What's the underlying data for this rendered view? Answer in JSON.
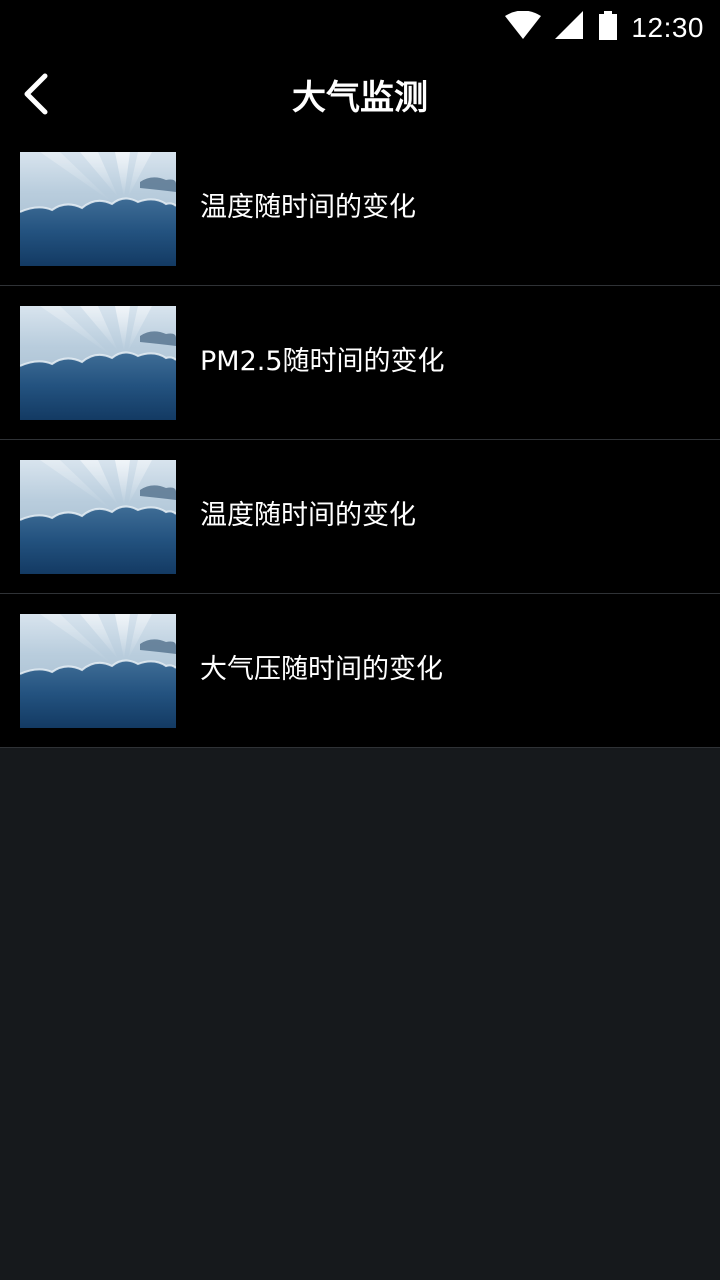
{
  "status_bar": {
    "time": "12:30",
    "icons": [
      "wifi-icon",
      "cell-signal-icon",
      "battery-icon"
    ]
  },
  "header": {
    "title": "大气监测",
    "back_icon": "chevron-left-icon"
  },
  "list": {
    "items": [
      {
        "label": "温度随时间的变化",
        "thumbnail": "sky-clouds-image"
      },
      {
        "label": "PM2.5随时间的变化",
        "thumbnail": "sky-clouds-image"
      },
      {
        "label": "温度随时间的变化",
        "thumbnail": "sky-clouds-image"
      },
      {
        "label": "大气压随时间的变化",
        "thumbnail": "sky-clouds-image"
      }
    ]
  },
  "colors": {
    "bar_background": "#000000",
    "page_background": "#16191c",
    "divider": "#2f3236",
    "text": "#ffffff"
  }
}
